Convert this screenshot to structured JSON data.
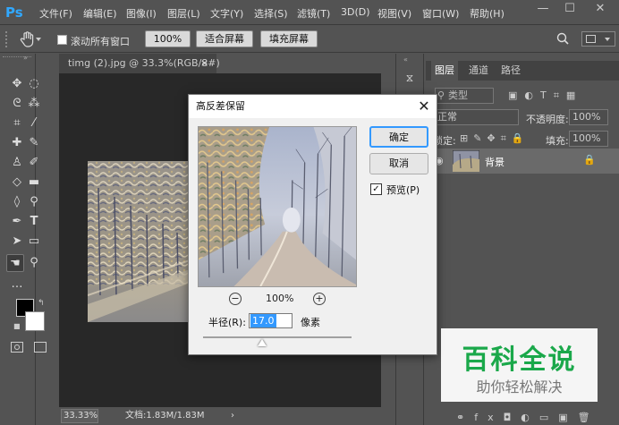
{
  "app": {
    "logo": "Ps"
  },
  "menu": [
    "文件(F)",
    "编辑(E)",
    "图像(I)",
    "图层(L)",
    "文字(Y)",
    "选择(S)",
    "滤镜(T)",
    "3D(D)",
    "视图(V)",
    "窗口(W)",
    "帮助(H)"
  ],
  "window_controls": {
    "minimize": "—",
    "restore": "☐",
    "close": "✕"
  },
  "options": {
    "scroll_all_label": "滚动所有窗口",
    "zoom_value": "100%",
    "fit_screen": "适合屏幕",
    "fill_screen": "填充屏幕"
  },
  "document": {
    "tab_title": "timg (2).jpg @ 33.3%(RGB/8#)",
    "tab_close": "×",
    "zoom": "33.33%",
    "doc_size": "文档:1.83M/1.83M",
    "status_arrow": "›"
  },
  "layers_panel": {
    "tabs": [
      "图层",
      "通道",
      "路径"
    ],
    "filter_kind": "类型",
    "blend_mode": "正常",
    "opacity_label": "不透明度:",
    "opacity_value": "100%",
    "lock_label": "锁定:",
    "fill_label": "填充:",
    "fill_value": "100%",
    "layer_name": "背景"
  },
  "dialog": {
    "title": "高反差保留",
    "close": "✕",
    "ok": "确定",
    "cancel": "取消",
    "preview_label": "预览(P)",
    "preview_checked": "✓",
    "zoom_level": "100%",
    "zoom_out": "−",
    "zoom_in": "+",
    "radius_label": "半径(R):",
    "radius_value": "17.0",
    "radius_unit": "像素",
    "slider_fraction": 0.4
  },
  "watermark": {
    "title": "百科全说",
    "subtitle": "助你轻松解决",
    "title_color": "#1aa84a"
  }
}
